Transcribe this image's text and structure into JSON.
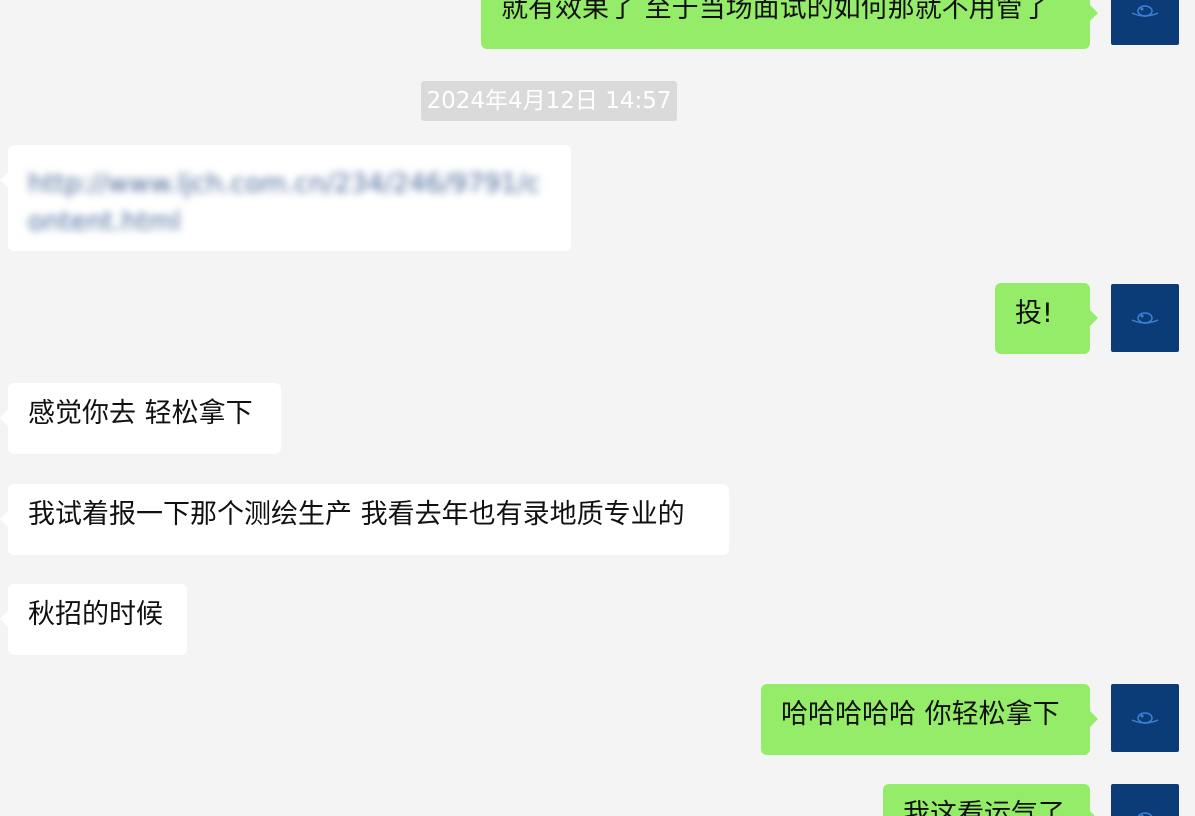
{
  "messages": {
    "m1": "就有效果了 至于当场面试的如何那就不用管了",
    "timestamp": "2024年4月12日 14:57",
    "m2_link": "http://www.ljch.com.cn/234/246/9791/content.html",
    "m3": "投!",
    "m4": "感觉你去 轻松拿下",
    "m5": "我试着报一下那个测绘生产 我看去年也有录地质专业的",
    "m6": "秋招的时候",
    "m7": "哈哈哈哈哈 你轻松拿下",
    "m8": "我这看运气了"
  },
  "colors": {
    "background": "#f4f4f4",
    "incoming_bubble": "#ffffff",
    "outgoing_bubble": "#95ec69",
    "avatar": "#0c3c78",
    "timestamp_bg": "#dadada"
  },
  "icons": {
    "avatar": "avatar-logo-icon"
  }
}
